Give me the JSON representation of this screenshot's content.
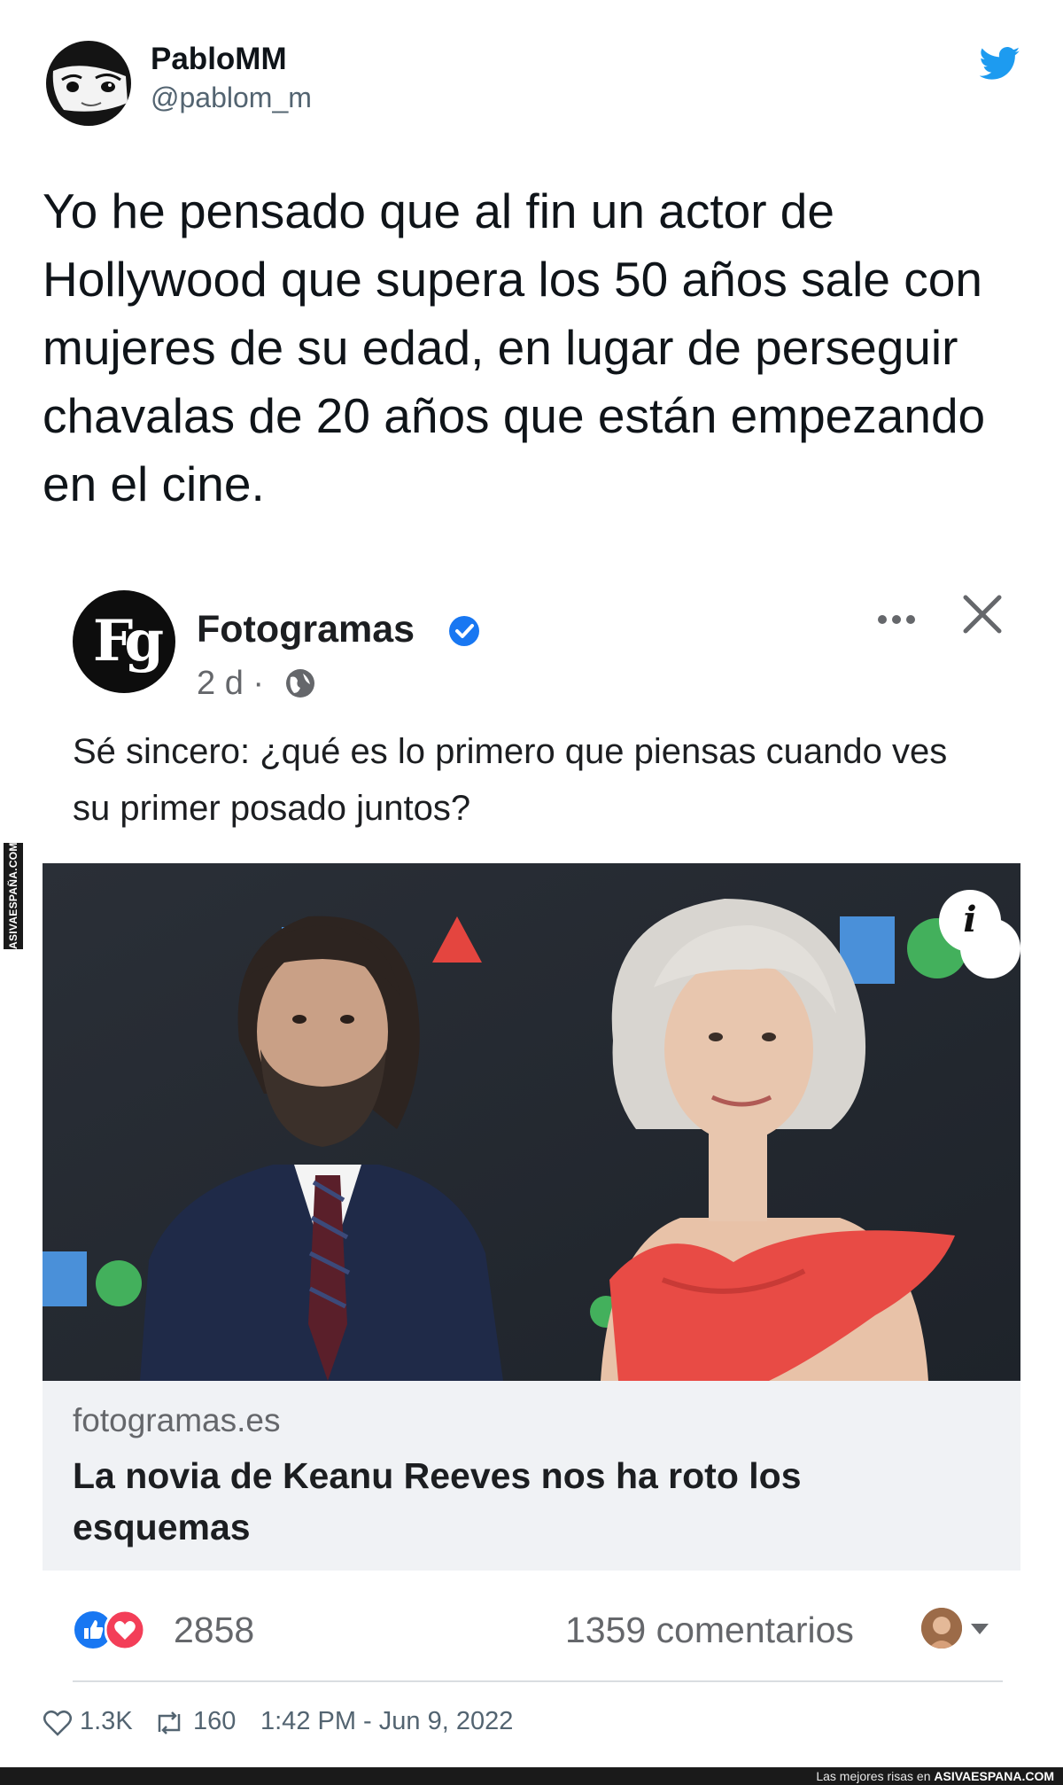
{
  "tweet": {
    "author_name": "PabloMM",
    "author_handle": "@pablom_m",
    "text": "Yo he pensado que al fin un actor de Hollywood que supera los 50 años sale con mujeres de su edad, en lugar de perseguir chavalas de 20 años que están empezando en el cine.",
    "footer": {
      "likes": "1.3K",
      "retweets": "160",
      "timestamp": "1:42 PM - Jun 9, 2022"
    }
  },
  "embedded_post": {
    "page_name": "Fotogramas",
    "logo_text": "Fg",
    "age": "2 d ·",
    "text": "Sé sincero: ¿qué es lo primero que piensas cuando ves su primer posado juntos?",
    "info_badge": "i",
    "link": {
      "domain": "fotogramas.es",
      "headline": "La novia de Keanu Reeves nos ha roto los esquemas"
    },
    "reactions_count": "2858",
    "comments_count": "1359 comentarios"
  },
  "watermark": {
    "side": "ASIVAESPAÑA.COM",
    "bottom_prefix": "Las mejores risas en",
    "bottom_site": "ASIVAESPANA.COM"
  },
  "colors": {
    "twitter_blue": "#1d9bf0",
    "facebook_blue": "#1877f2",
    "love_red": "#f33e58"
  },
  "icons": [
    "twitter-bird-icon",
    "verified-badge-icon",
    "globe-icon",
    "more-icon",
    "close-icon",
    "info-icon",
    "like-reaction-icon",
    "love-reaction-icon",
    "chevron-down-icon",
    "heart-icon",
    "retweet-icon"
  ]
}
